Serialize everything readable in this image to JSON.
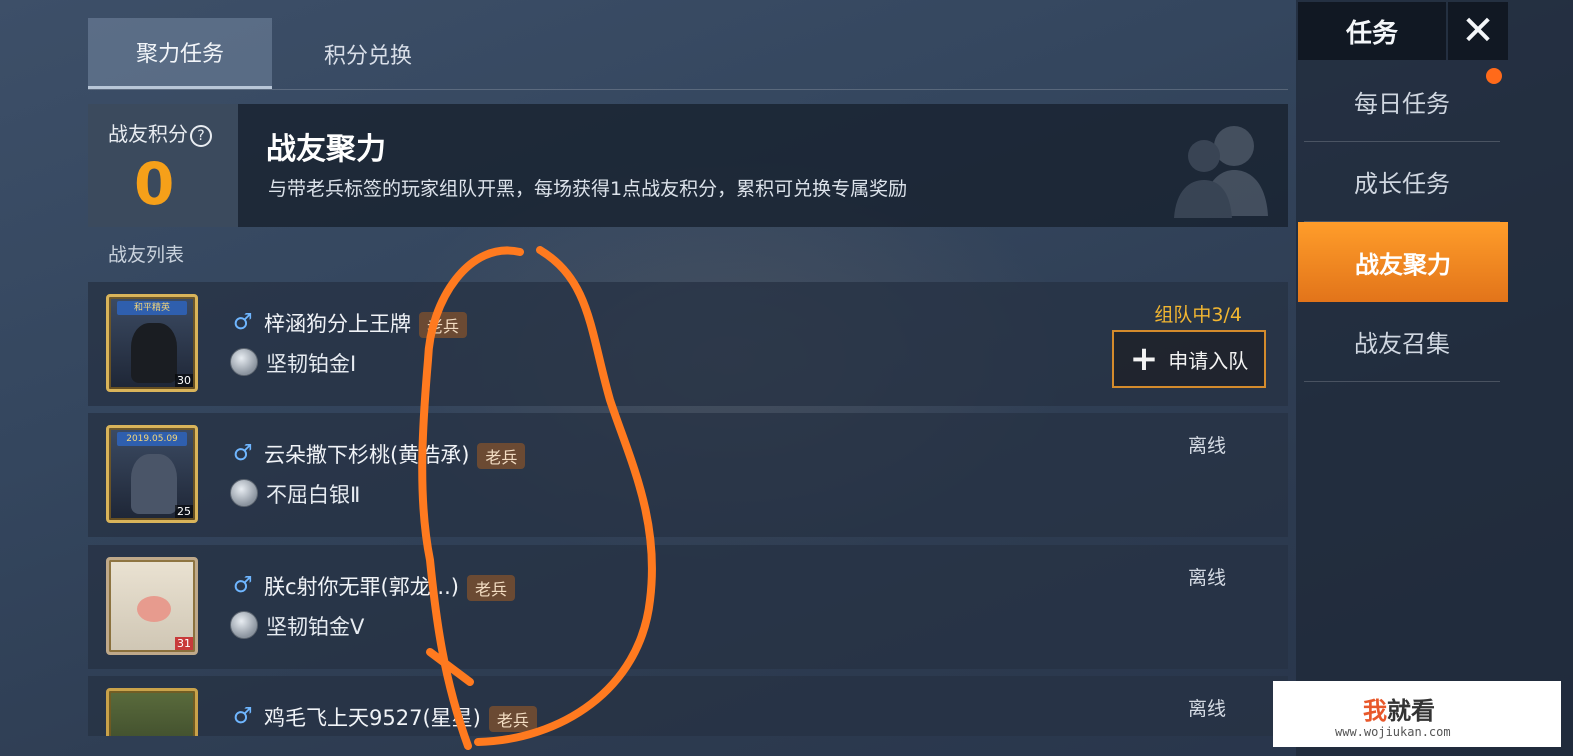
{
  "tabs": {
    "active_label": "聚力任务",
    "second_label": "积分兑换"
  },
  "banner": {
    "score_label": "战友积分",
    "help_icon": "question-circle-icon",
    "score_value": "0",
    "title": "战友聚力",
    "description": "与带老兵标签的玩家组队开黑，每场获得1点战友积分，累积可兑换专属奖励"
  },
  "list": {
    "title": "战友列表",
    "veteran_tag": "老兵",
    "players": [
      {
        "gender_icon": "male-icon",
        "name": "梓涵狗分上王牌",
        "tag": "老兵",
        "rank": "坚韧铂金Ⅰ",
        "level": "30",
        "status": "组队中3/4",
        "action_label": "申请入队",
        "avatar_ribbon": "和平精英"
      },
      {
        "gender_icon": "male-icon",
        "name": "云朵撒下杉桃(黄浩承)",
        "tag": "老兵",
        "rank": "不屈白银Ⅱ",
        "level": "25",
        "status": "离线",
        "avatar_ribbon": "2019.05.09"
      },
      {
        "gender_icon": "male-icon",
        "name": "朕c射你无罪(郭龙...)",
        "tag": "老兵",
        "rank": "坚韧铂金Ⅴ",
        "level": "31",
        "status": "离线"
      },
      {
        "gender_icon": "male-icon",
        "name": "鸡毛飞上天9527(星星)",
        "tag": "老兵",
        "status": "离线"
      }
    ]
  },
  "sidebar": {
    "title": "任务",
    "close_icon": "close-icon",
    "items": [
      {
        "label": "每日任务"
      },
      {
        "label": "成长任务"
      },
      {
        "label": "战友聚力"
      },
      {
        "label": "战友召集"
      }
    ]
  },
  "watermark": {
    "brand_highlight": "我",
    "brand_rest": "就看",
    "url": "www.wojiukan.com"
  },
  "colors": {
    "accent_orange": "#f6a019",
    "active_tab_orange": "#ff9d2a",
    "status_team": "#f2b631",
    "annotation": "#ff7a1f"
  }
}
